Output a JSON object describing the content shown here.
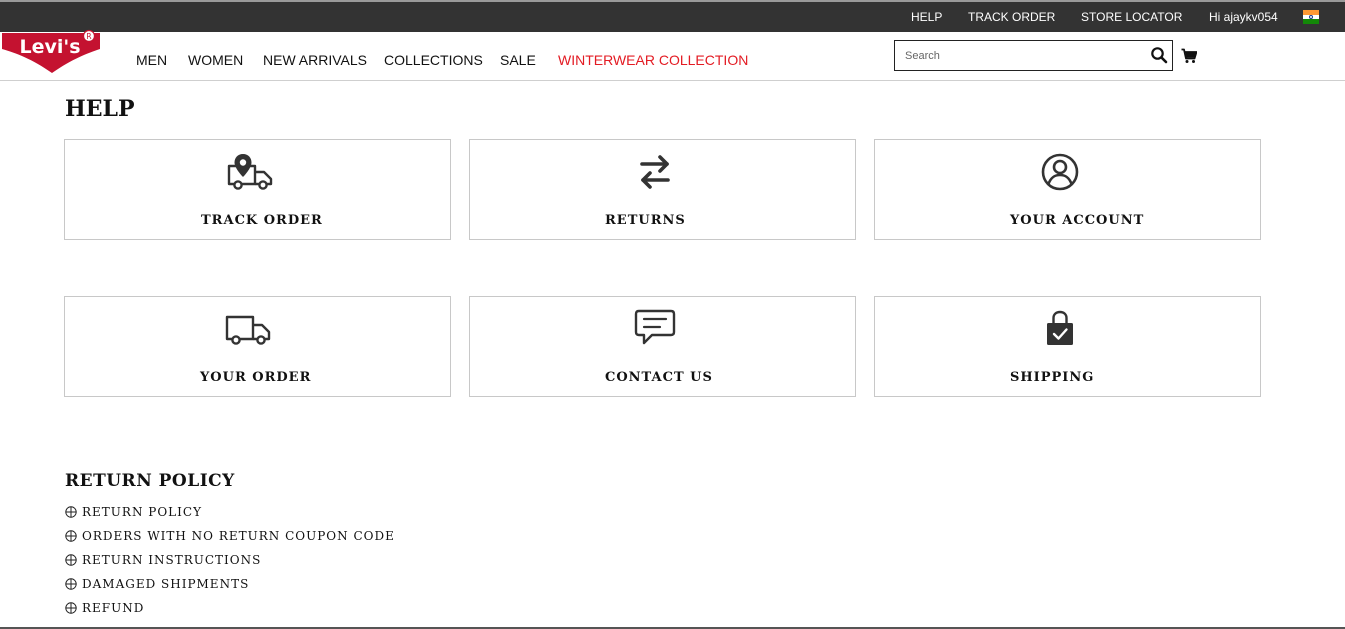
{
  "utility_nav": {
    "links": [
      {
        "label": "HELP"
      },
      {
        "label": "TRACK ORDER"
      },
      {
        "label": "STORE LOCATOR"
      },
      {
        "label": "Hi ajaykv054"
      }
    ]
  },
  "brand": {
    "logo_text": "Levi's",
    "registered_mark": "R",
    "logo_color": "#c41230"
  },
  "main_nav": {
    "items": [
      {
        "label": "MEN"
      },
      {
        "label": "WOMEN"
      },
      {
        "label": "NEW ARRIVALS"
      },
      {
        "label": "COLLECTIONS"
      },
      {
        "label": "SALE"
      },
      {
        "label": "WINTERWEAR COLLECTION",
        "color": "#e31b23"
      }
    ]
  },
  "search": {
    "placeholder": "Search",
    "value": ""
  },
  "page": {
    "title": "HELP"
  },
  "help_cards": [
    {
      "label": "TRACK ORDER",
      "icon": "truck-location-icon"
    },
    {
      "label": "RETURNS",
      "icon": "swap-arrows-icon"
    },
    {
      "label": "YOUR ACCOUNT",
      "icon": "user-circle-icon"
    },
    {
      "label": "YOUR ORDER",
      "icon": "delivery-truck-icon"
    },
    {
      "label": "CONTACT US",
      "icon": "chat-bubble-icon"
    },
    {
      "label": "SHIPPING",
      "icon": "shopping-bag-check-icon"
    }
  ],
  "return_policy": {
    "title": "RETURN POLICY",
    "items": [
      {
        "label": "RETURN POLICY"
      },
      {
        "label": "ORDERS WITH NO RETURN COUPON CODE"
      },
      {
        "label": "RETURN INSTRUCTIONS"
      },
      {
        "label": "DAMAGED SHIPMENTS"
      },
      {
        "label": "REFUND"
      }
    ]
  },
  "colors": {
    "utility_bar": "#333333",
    "accent_red": "#e31b23",
    "card_border": "#c8c8c8"
  }
}
